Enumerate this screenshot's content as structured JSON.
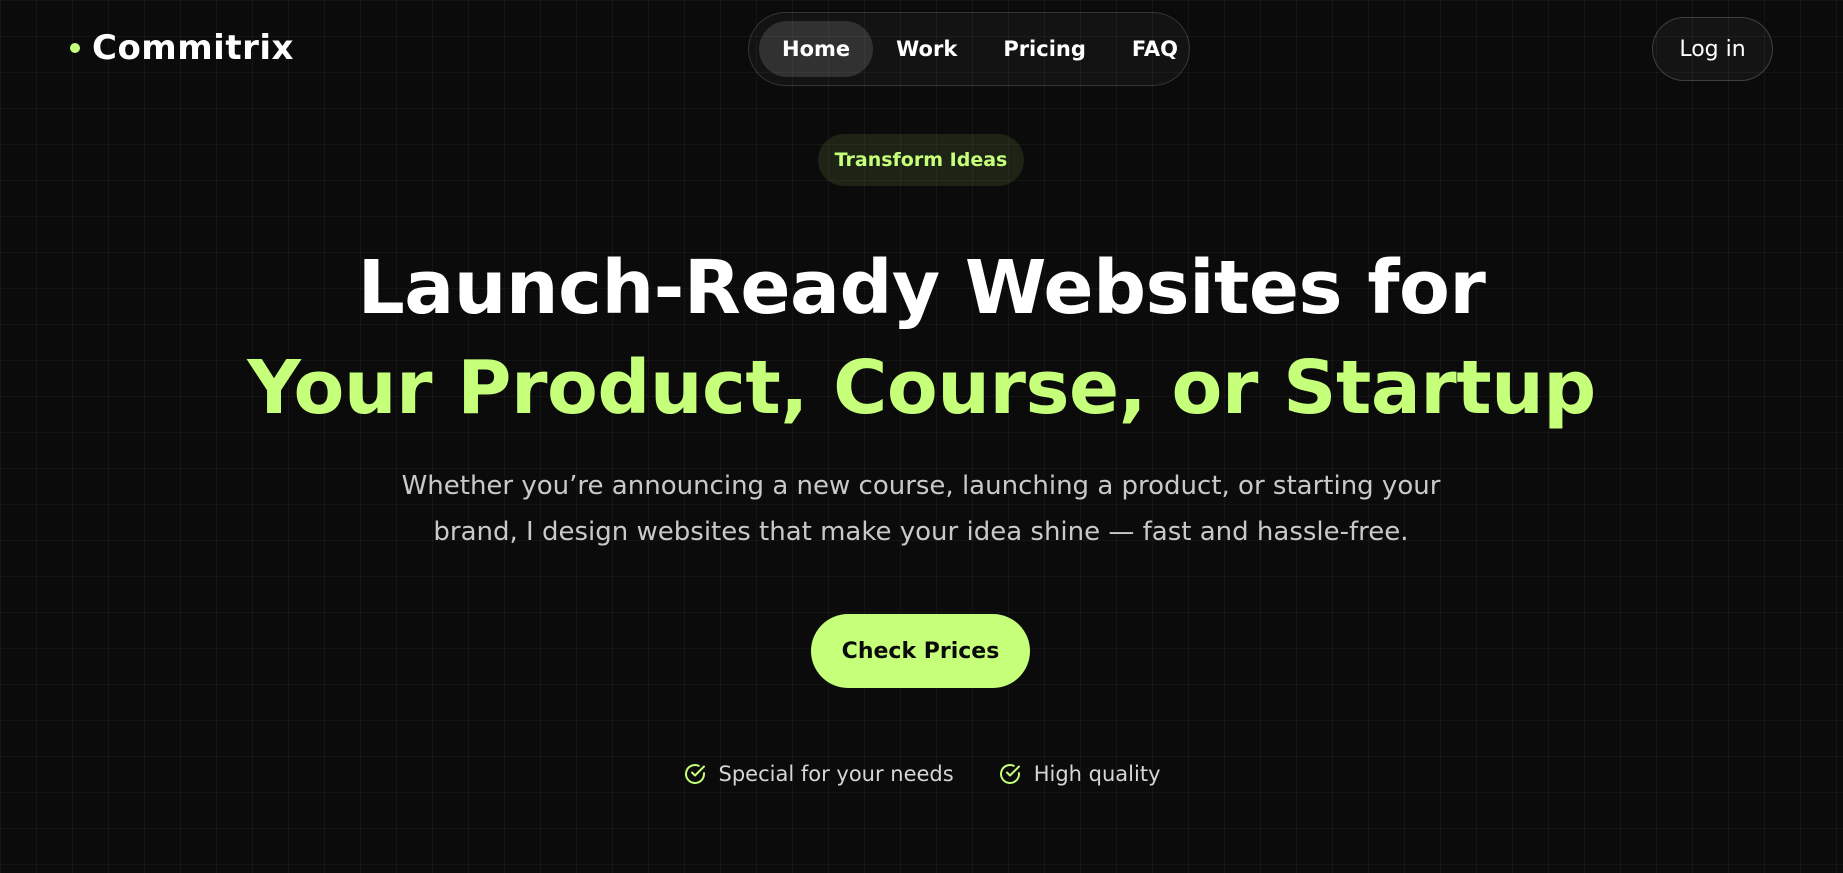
{
  "colors": {
    "accent": "#c6ff7a",
    "background": "#0b0b0b",
    "text": "#ffffff",
    "muted": "#c9c9c9"
  },
  "brand": {
    "name": "Commitrix",
    "dot_icon": "dot-icon"
  },
  "nav": {
    "items": [
      {
        "label": "Home",
        "active": true
      },
      {
        "label": "Work",
        "active": false
      },
      {
        "label": "Pricing",
        "active": false
      },
      {
        "label": "FAQ",
        "active": false
      }
    ]
  },
  "header": {
    "login_label": "Log in"
  },
  "hero": {
    "badge": "Transform Ideas",
    "headline_line1": "Launch-Ready Websites for",
    "headline_line2": "Your Product, Course, or Startup",
    "subtitle_line1": "Whether you’re announcing a new course, launching a product, or starting your",
    "subtitle_line2": "brand, I design websites that make your idea shine — fast and hassle-free.",
    "cta_label": "Check Prices"
  },
  "features": [
    {
      "icon": "check-circle-icon",
      "label": "Special for your needs"
    },
    {
      "icon": "check-circle-icon",
      "label": "High quality"
    }
  ]
}
